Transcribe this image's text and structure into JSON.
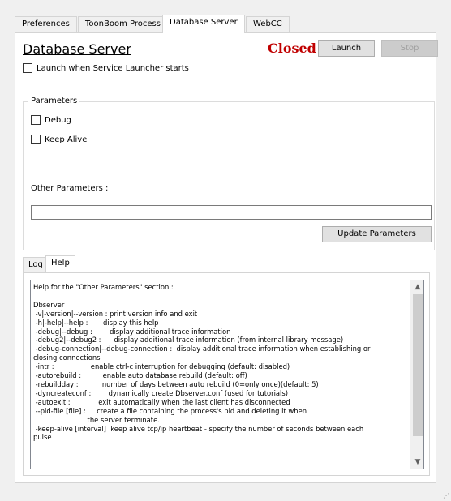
{
  "tabs": [
    "Preferences",
    "ToonBoom Process",
    "Database Server",
    "WebCC"
  ],
  "header": {
    "title": "Database Server",
    "status": "Closed",
    "launch_label": "Launch",
    "stop_label": "Stop"
  },
  "launch_on_start_label": "Launch when Service Launcher starts",
  "parameters": {
    "legend": "Parameters",
    "debug_label": "Debug",
    "keep_alive_label": "Keep Alive",
    "other_label": "Other Parameters :",
    "other_value": "",
    "update_label": "Update Parameters"
  },
  "inner_tabs": [
    "Log",
    "Help"
  ],
  "help_lines": [
    "Help for the \"Other Parameters\" section :",
    "",
    "Dbserver",
    " -v|-version|--version : print version info and exit",
    " -h|-help|--help :       display this help",
    " -debug|--debug :        display additional trace information",
    " -debug2|--debug2 :      display additional trace information (from internal library message)",
    " -debug-connection|--debug-connection :  display additional trace information when establishing or",
    "closing connections",
    " -intr :                 enable ctrl-c interruption for debugging (default: disabled)",
    " -autorebuild :          enable auto database rebuild (default: off)",
    " -rebuildday :           number of days between auto rebuild (0=only once)(default: 5)",
    " -dyncreateconf :        dynamically create Dbserver.conf (used for tutorials)",
    " -autoexit :             exit automatically when the last client has disconnected",
    " --pid-file [file] :     create a file containing the process's pid and deleting it when",
    "                         the server terminate.",
    " -keep-alive [interval]  keep alive tcp/ip heartbeat - specify the number of seconds between each",
    "pulse"
  ]
}
